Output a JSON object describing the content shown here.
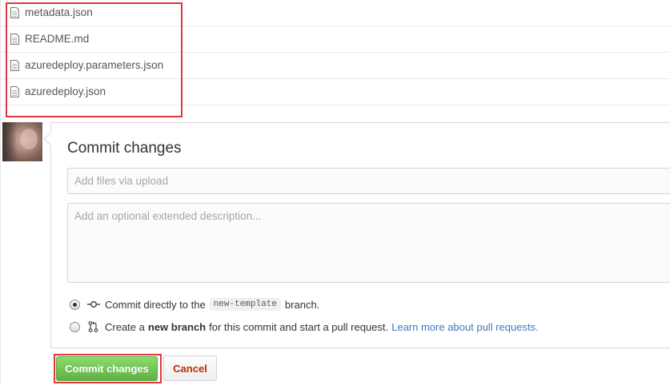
{
  "files": [
    {
      "name": "metadata.json",
      "icon": "file-icon"
    },
    {
      "name": "README.md",
      "icon": "file-icon"
    },
    {
      "name": "azuredeploy.parameters.json",
      "icon": "file-icon"
    },
    {
      "name": "azuredeploy.json",
      "icon": "file-icon"
    }
  ],
  "commit": {
    "title": "Commit changes",
    "summary_placeholder": "Add files via upload",
    "description_placeholder": "Add an optional extended description...",
    "options": [
      {
        "selected": true,
        "icon": "commit-icon",
        "prefix": "Commit directly to the",
        "branch": "new-template",
        "suffix": "branch."
      },
      {
        "selected": false,
        "icon": "pull-request-icon",
        "prefix": "Create a",
        "bold": "new branch",
        "suffix": "for this commit and start a pull request.",
        "link": "Learn more about pull requests."
      }
    ],
    "submit_label": "Commit changes",
    "cancel_label": "Cancel"
  },
  "colors": {
    "highlight": "#e0373f",
    "primary_button": "#60b044",
    "cancel_text": "#bd2c00",
    "link": "#4078c0"
  }
}
